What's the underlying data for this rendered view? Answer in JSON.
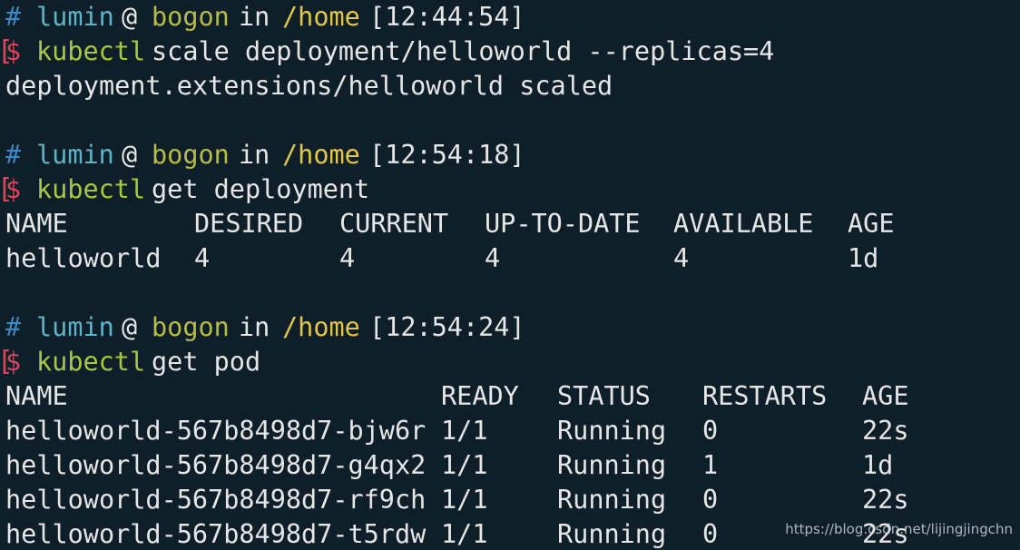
{
  "colors": {
    "background": "#0f1f29",
    "prompt_hash": "#3f88c5",
    "user": "#5fb5c7",
    "host": "#b8bd45",
    "path": "#e3c64c",
    "dollar": "#d9465a",
    "command": "#a7c940",
    "text": "#e6e6e6"
  },
  "prompts": [
    {
      "hash": "#",
      "user": "lumin",
      "at": "@",
      "host": "bogon",
      "in": "in",
      "path": "/home",
      "time": "[12:44:54]",
      "bracket": "[",
      "dollar": "$",
      "command": "kubectl",
      "args": "scale deployment/helloworld --replicas=4"
    },
    {
      "hash": "#",
      "user": "lumin",
      "at": "@",
      "host": "bogon",
      "in": "in",
      "path": "/home",
      "time": "[12:54:18]",
      "bracket": "[",
      "dollar": "$",
      "command": "kubectl",
      "args": "get deployment"
    },
    {
      "hash": "#",
      "user": "lumin",
      "at": "@",
      "host": "bogon",
      "in": "in",
      "path": "/home",
      "time": "[12:54:24]",
      "bracket": "[",
      "dollar": "$",
      "command": "kubectl",
      "args": "get pod"
    }
  ],
  "output_scale": "deployment.extensions/helloworld scaled",
  "deployment_table": {
    "headers": [
      "NAME",
      "DESIRED",
      "CURRENT",
      "UP-TO-DATE",
      "AVAILABLE",
      "AGE"
    ],
    "rows": [
      [
        "helloworld",
        "4",
        "4",
        "4",
        "4",
        "1d"
      ]
    ]
  },
  "pod_table": {
    "headers": [
      "NAME",
      "READY",
      "STATUS",
      "RESTARTS",
      "AGE"
    ],
    "rows": [
      [
        "helloworld-567b8498d7-bjw6r",
        "1/1",
        "Running",
        "0",
        "22s"
      ],
      [
        "helloworld-567b8498d7-g4qx2",
        "1/1",
        "Running",
        "1",
        "1d"
      ],
      [
        "helloworld-567b8498d7-rf9ch",
        "1/1",
        "Running",
        "0",
        "22s"
      ],
      [
        "helloworld-567b8498d7-t5rdw",
        "1/1",
        "Running",
        "0",
        "22s"
      ]
    ]
  },
  "watermark": "https://blog.csdn.net/lijingjingchn"
}
